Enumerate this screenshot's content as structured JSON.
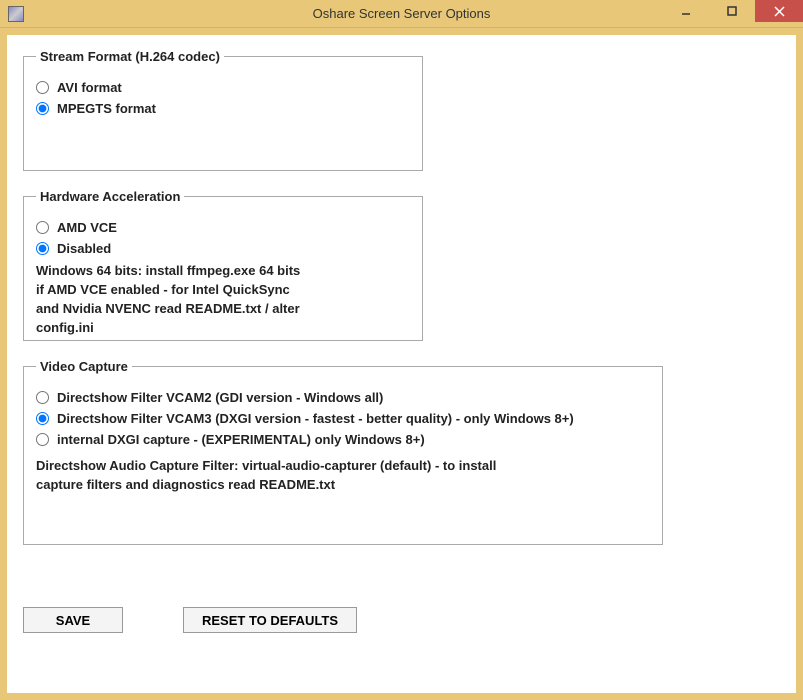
{
  "window": {
    "title": "Oshare Screen Server Options"
  },
  "streamFormat": {
    "legend": "Stream Format (H.264 codec)",
    "options": {
      "avi": "AVI format",
      "mpegts": "MPEGTS format"
    },
    "selected": "mpegts"
  },
  "hardwareAccel": {
    "legend": "Hardware Acceleration",
    "options": {
      "amd": "AMD VCE",
      "disabled": "Disabled"
    },
    "selected": "disabled",
    "info": "Windows 64 bits: install ffmpeg.exe 64 bits\nif AMD VCE enabled - for Intel QuickSync\nand Nvidia NVENC read README.txt / alter\nconfig.ini"
  },
  "videoCapture": {
    "legend": "Video Capture",
    "options": {
      "vcam2": "Directshow Filter VCAM2 (GDI version - Windows all)",
      "vcam3": "Directshow Filter VCAM3 (DXGI version - fastest - better quality) - only Windows 8+)",
      "internal": "internal DXGI capture - (EXPERIMENTAL) only Windows 8+)"
    },
    "selected": "vcam3",
    "info": "Directshow Audio Capture Filter: virtual-audio-capturer (default) - to install\ncapture filters and diagnostics read README.txt"
  },
  "buttons": {
    "save": "SAVE",
    "reset": "RESET TO DEFAULTS"
  }
}
